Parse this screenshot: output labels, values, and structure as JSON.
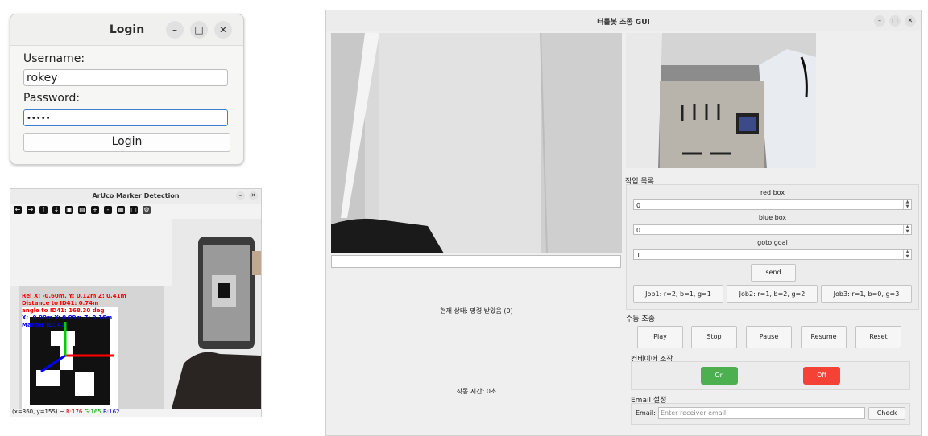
{
  "login": {
    "title": "Login",
    "username_label": "Username:",
    "username_value": "rokey",
    "password_label": "Password:",
    "password_value": "•••••",
    "login_button": "Login",
    "controls": {
      "minimize": "–",
      "maximize": "□",
      "close": "✕"
    }
  },
  "aruco": {
    "title": "ArUco Marker Detection",
    "toolbar_icons": [
      "arrow-left-icon",
      "arrow-right-icon",
      "arrow-up-icon",
      "arrow-down-icon",
      "pan-icon",
      "save-icon",
      "zoom-in-icon",
      "zoom-out-icon",
      "copy-icon",
      "fit-icon",
      "settings-icon"
    ],
    "overlay": {
      "line1": "Rel X: -0.60m, Y: 0.12m Z: 0.41m",
      "line2": "Distance to ID41: 0.74m",
      "line3": "angle to ID41: 168.30 deg",
      "line4": "X: -0.90m Y: 0.09m Z: 0.16m",
      "line5": "Marker ID: 41"
    },
    "status": {
      "coords": "(x=360, y=155) ~",
      "r": "R:176",
      "g": "G:165",
      "b": "B:162"
    },
    "colors": {
      "red": "#ff0000",
      "blue": "#0000ff",
      "green": "#00cc00"
    }
  },
  "turtle": {
    "title": "터틀봇 조종 GUI",
    "command_input": "",
    "status_text": "현재 상태: 명령 받았음 (0)",
    "runtime_text": "작동 시간: 0초",
    "job_section": "작업 목록",
    "red_box_label": "red box",
    "red_box_value": "0",
    "blue_box_label": "blue box",
    "blue_box_value": "0",
    "goto_goal_label": "goto goal",
    "goto_goal_value": "1",
    "send_button": "send",
    "job_buttons": [
      "Job1: r=2, b=1, g=1",
      "Job2: r=1, b=2, g=2",
      "Job3: r=1, b=0, g=3"
    ],
    "manual_section": "수동 조종",
    "manual_buttons": [
      "Play",
      "Stop",
      "Pause",
      "Resume",
      "Reset"
    ],
    "conveyor_section": "컨베이어 조작",
    "conveyor_on": "On",
    "conveyor_off": "Off",
    "email_section": "Email 설정",
    "email_label": "Email:",
    "email_placeholder": "Enter receiver email",
    "check_button": "Check",
    "colors": {
      "on": "#4caf50",
      "off": "#f44336"
    }
  }
}
